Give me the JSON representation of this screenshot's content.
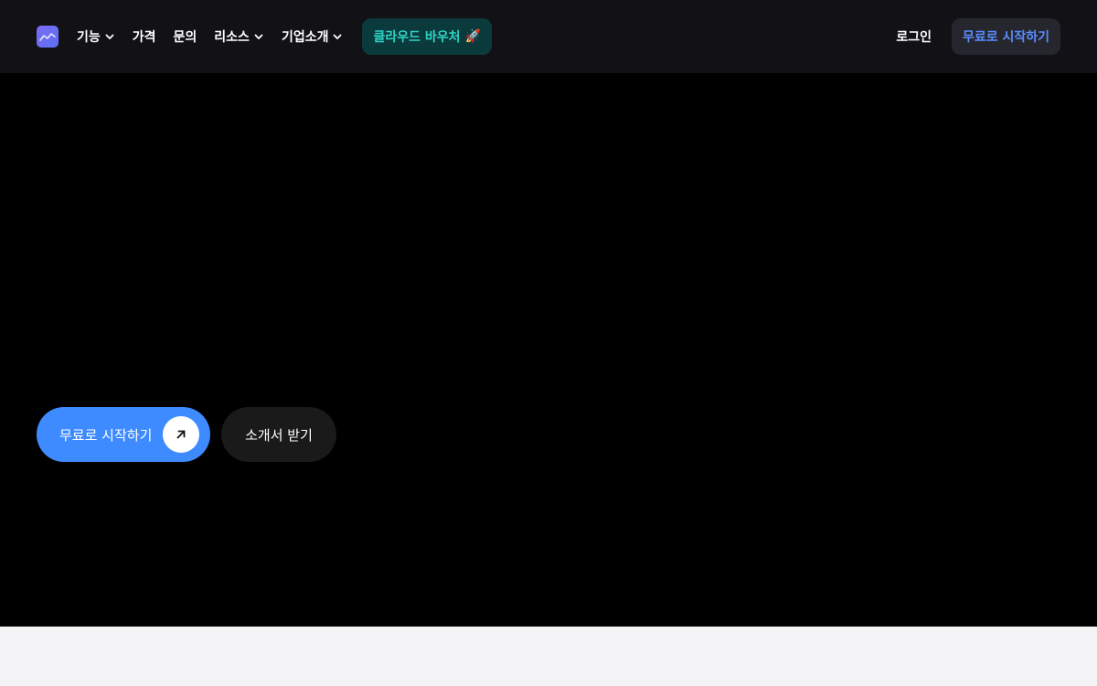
{
  "nav": {
    "logo_icon": "chart-trend-icon",
    "items": [
      {
        "label": "기능",
        "has_dropdown": true
      },
      {
        "label": "가격",
        "has_dropdown": false
      },
      {
        "label": "문의",
        "has_dropdown": false
      },
      {
        "label": "리소스",
        "has_dropdown": true
      },
      {
        "label": "기업소개",
        "has_dropdown": true
      }
    ],
    "promo_label": "클라우드 바우처",
    "promo_emoji": "🚀",
    "login_label": "로그인",
    "start_label": "무료로 시작하기"
  },
  "hero": {
    "primary_cta": "무료로 시작하기",
    "primary_cta_icon": "arrow-up-right-icon",
    "secondary_cta": "소개서 받기"
  },
  "colors": {
    "nav_bg": "#111116",
    "promo_bg": "#0b3a3c",
    "promo_text": "#2fd4c4",
    "accent_blue": "#3d8bff",
    "start_text": "#5b8cff",
    "hero_bg": "#000000",
    "footer_bg": "#f4f4f6"
  }
}
